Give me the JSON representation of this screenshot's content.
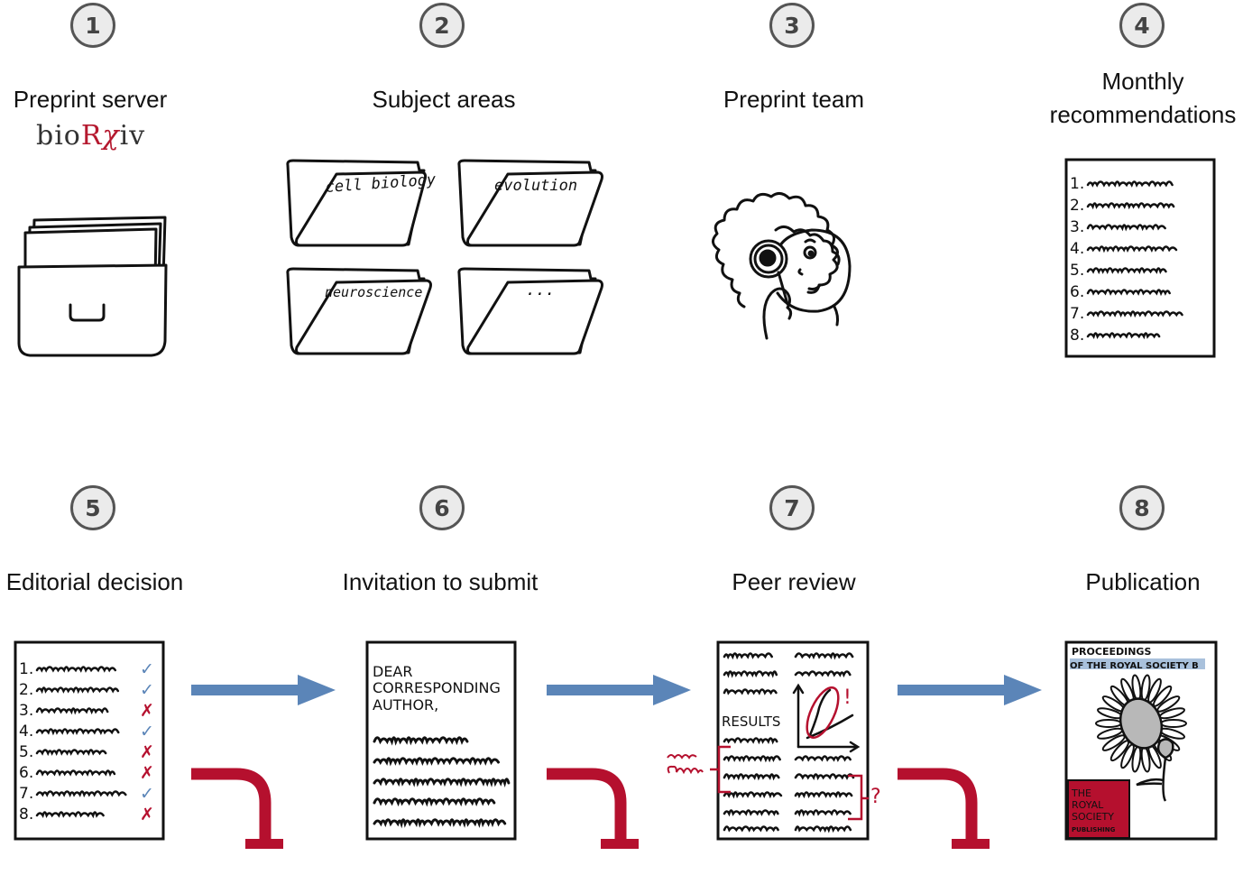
{
  "colors": {
    "accept": "#5b85b8",
    "reject": "#b5102e",
    "badge_bg": "#ebebeb",
    "badge_border": "#555555",
    "flower_center": "#b8b8b8"
  },
  "steps": [
    {
      "number": "1",
      "title": "Preprint server",
      "logo": {
        "pre": "bio",
        "mid": "R",
        "chi": "χ",
        "post": "iv"
      }
    },
    {
      "number": "2",
      "title": "Subject areas",
      "folders": [
        "cell biology",
        "evolution",
        "neuroscience",
        "..."
      ]
    },
    {
      "number": "3",
      "title": "Preprint team"
    },
    {
      "number": "4",
      "title_line1": "Monthly",
      "title_line2": "recommendations",
      "list_numbers": [
        "1.",
        "2.",
        "3.",
        "4.",
        "5.",
        "6.",
        "7.",
        "8."
      ]
    },
    {
      "number": "5",
      "title": "Editorial decision",
      "decisions": [
        "accept",
        "accept",
        "reject",
        "accept",
        "reject",
        "reject",
        "accept",
        "reject"
      ],
      "check_glyph": "✓",
      "cross_glyph": "✗"
    },
    {
      "number": "6",
      "title": "Invitation to submit",
      "letter": {
        "line1": "DEAR",
        "line2": "CORRESPONDING",
        "line3": "AUTHOR,"
      }
    },
    {
      "number": "7",
      "title": "Peer review",
      "review": {
        "heading": "RESULTS",
        "mark_exclaim": "!",
        "mark_question": "?"
      }
    },
    {
      "number": "8",
      "title": "Publication",
      "journal": {
        "line1": "PROCEEDINGS",
        "line2": "OF THE ROYAL SOCIETY B"
      },
      "publisher": {
        "line1": "THE",
        "line2": "ROYAL",
        "line3": "SOCIETY",
        "line4": "PUBLISHING"
      }
    }
  ],
  "flow": {
    "forward_arrows": [
      "step5-to-step6",
      "step6-to-step7",
      "step7-to-step8"
    ],
    "rejection_branches": [
      "step5-rejected",
      "step6-rejected",
      "step7-rejected"
    ]
  }
}
